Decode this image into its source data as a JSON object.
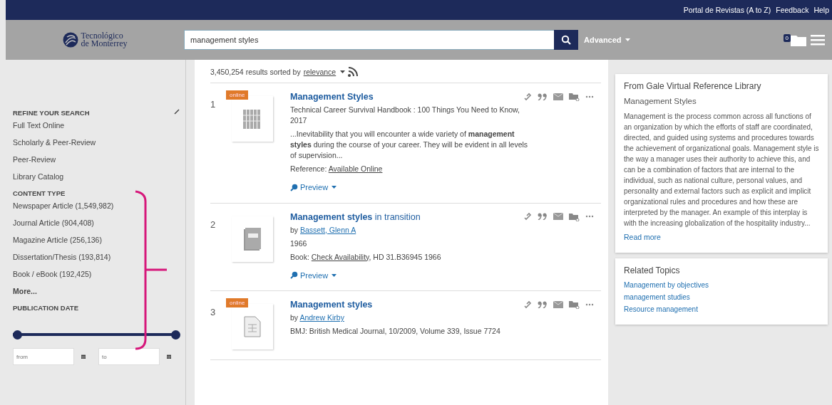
{
  "top_links": [
    "Portal de Revistas (A to Z)",
    "Feedback",
    "Help"
  ],
  "header": {
    "logo_line1": "Tecnológico",
    "logo_line2": "de Monterrey",
    "search_value": "management styles",
    "advanced": "Advanced",
    "folder_count": "0"
  },
  "sidebar": {
    "refine_title": "REFINE YOUR SEARCH",
    "refine_items": [
      "Full Text Online",
      "Scholarly & Peer-Review",
      "Peer-Review",
      "Library Catalog"
    ],
    "content_type_title": "CONTENT TYPE",
    "content_types": [
      "Newspaper Article (1,549,982)",
      "Journal Article (904,408)",
      "Magazine Article (256,136)",
      "Dissertation/Thesis (193,814)",
      "Book / eBook (192,425)"
    ],
    "more": "More...",
    "publication_date_title": "PUBLICATION DATE",
    "slider": {
      "start": {
        "level": 0
      },
      "end": {
        "level": 1
      }
    },
    "from_placeholder": "from",
    "to_placeholder": "to"
  },
  "results_header": {
    "count": "3,450,254 results sorted by",
    "sort": "relevance"
  },
  "results": [
    {
      "number": "1",
      "online": true,
      "badge": "online",
      "kind": "grid",
      "title": "Management Styles",
      "lines": [
        {
          "kind": "text",
          "text": "Technical Career Survival Handbook : 100 Things You Need to Know, 2017"
        },
        {
          "kind": "snippet",
          "text": "...Inevitability that you will encounter a wide variety of **management styles** during the course of your career. They will be evident in all levels of supervision..."
        },
        {
          "kind": "access",
          "label": "Reference:",
          "link": "Available Online"
        }
      ],
      "preview": "Preview"
    },
    {
      "number": "2",
      "online": false,
      "kind": "book",
      "title": "**Management styles** in transition",
      "lines": [
        {
          "kind": "byline",
          "label": "by",
          "link": "Bassett, Glenn A"
        },
        {
          "kind": "text",
          "text": "1966"
        },
        {
          "kind": "access",
          "label": "Book:",
          "link": "Check Availability",
          "after": ", HD 31.B36945 1966"
        }
      ],
      "preview": "Preview"
    },
    {
      "number": "3",
      "online": true,
      "badge": "online",
      "kind": "document",
      "title": "Management styles",
      "lines": [
        {
          "kind": "byline",
          "label": "by",
          "link": "Andrew Kirby"
        },
        {
          "kind": "text",
          "text": "BMJ: British Medical Journal, 10/2009, Volume 339, Issue 7724"
        }
      ]
    }
  ],
  "reference_card": {
    "source": "From Gale Virtual Reference Library",
    "title": "Management Styles",
    "body": "Management is the process common across all functions of an organization by which the efforts of staff are coordinated, directed, and guided using systems and procedures towards the achievement of organizational goals. Management style is the way a manager uses their authority to achieve this, and can be a combination of factors that are internal to the individual, such as national culture, personal values, and personality and external factors such as explicit and implicit organizational rules and procedures and how these are interpreted by the manager. An example of this interplay is with the increasing globalization of the hospitality industry...",
    "read_more": "Read more"
  },
  "related_topics": {
    "title": "Related Topics",
    "items": [
      "Management by objectives",
      "management studies",
      "Resource management"
    ]
  }
}
